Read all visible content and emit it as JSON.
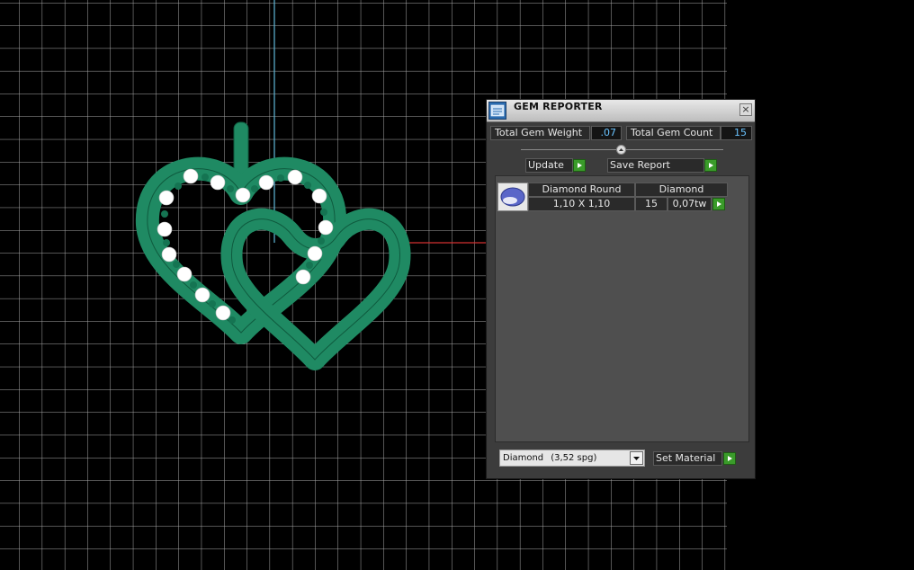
{
  "viewport": {
    "background": "#000000",
    "grid_color": "#bdbdbd",
    "model_color": "#1f8a63",
    "stone_color": "#ffffff"
  },
  "gem_reporter": {
    "title": "GEM REPORTER",
    "app_icon": "gem-reporter-icon",
    "close_label": "×",
    "total_gem_weight_label": "Total Gem Weight",
    "total_gem_weight_value": ".07",
    "total_gem_count_label": "Total Gem Count",
    "total_gem_count_value": "15",
    "update_label": "Update",
    "save_report_label": "Save Report",
    "gems": [
      {
        "shape": "Diamond Round",
        "material": "Diamond",
        "size": "1,10 X 1,10",
        "count": "15",
        "weight": "0,07tw"
      }
    ],
    "material_select": {
      "name": "Diamond",
      "density": "(3,52 spg)"
    },
    "set_material_label": "Set Material",
    "accent_color": "#3a9b2a"
  }
}
